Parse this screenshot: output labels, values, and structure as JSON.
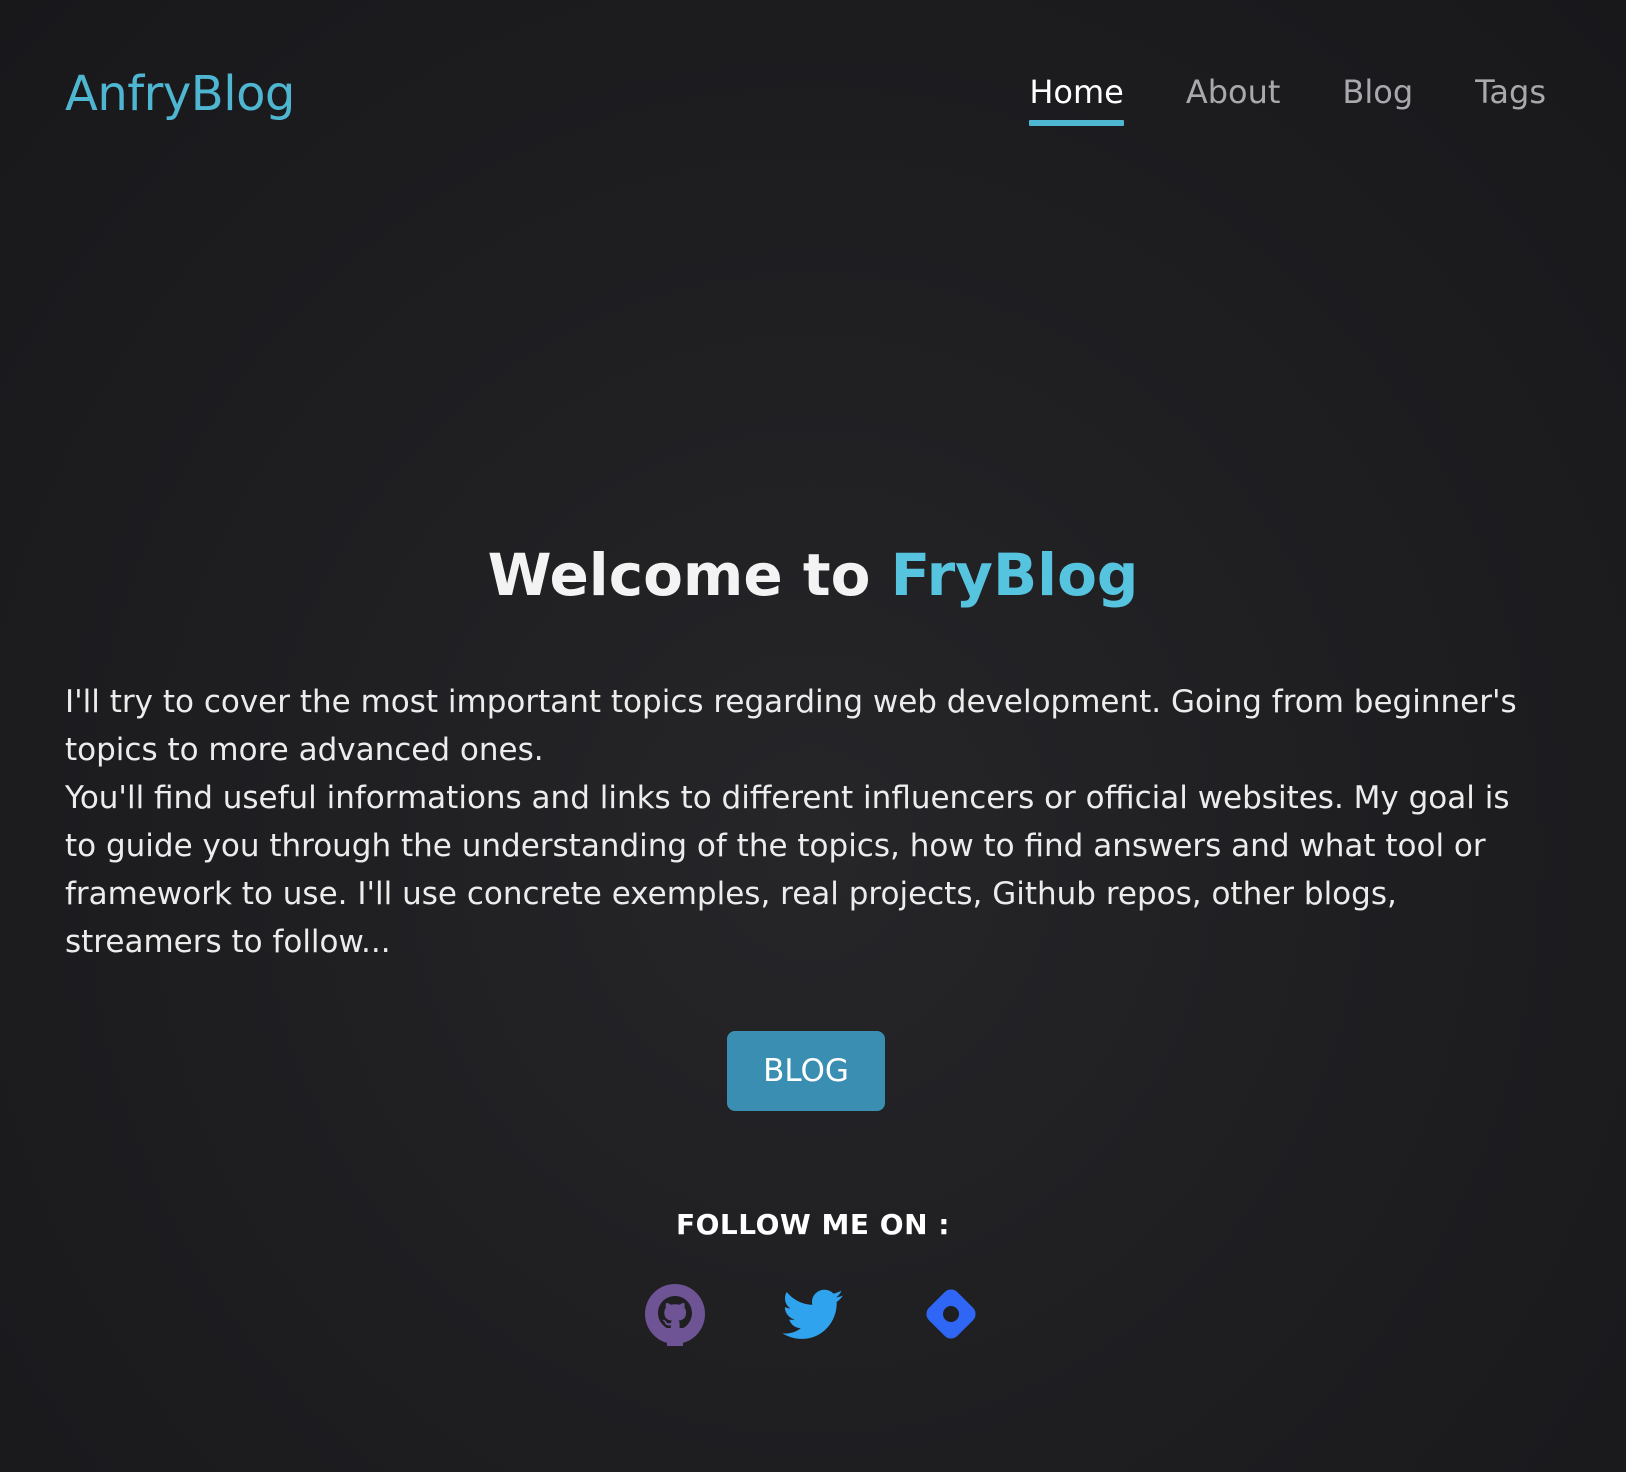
{
  "site": {
    "logo": "AnfryBlog"
  },
  "nav": {
    "items": [
      {
        "label": "Home",
        "active": true
      },
      {
        "label": "About",
        "active": false
      },
      {
        "label": "Blog",
        "active": false
      },
      {
        "label": "Tags",
        "active": false
      }
    ]
  },
  "hero": {
    "title_prefix": "Welcome to ",
    "title_accent": "FryBlog",
    "paragraph_1": "I'll try to cover the most important topics regarding web development. Going from beginner's topics to more advanced ones.",
    "paragraph_2": "You'll find useful informations and links to different influencers or official websites. My goal is to guide you through the understanding of the topics, how to find answers and what tool or framework to use. I'll use concrete exemples, real projects, Github repos, other blogs, streamers to follow...",
    "button_label": "BLOG"
  },
  "follow": {
    "heading": "FOLLOW ME ON :",
    "links": [
      {
        "icon": "github-icon",
        "color": "#6e5494"
      },
      {
        "icon": "twitter-icon",
        "color": "#1da1f2"
      },
      {
        "icon": "diamond-icon",
        "color": "#2f66f5"
      }
    ]
  },
  "colors": {
    "accent": "#4fb6d2",
    "button": "#3a8eb1",
    "background": "#1f1f22"
  }
}
